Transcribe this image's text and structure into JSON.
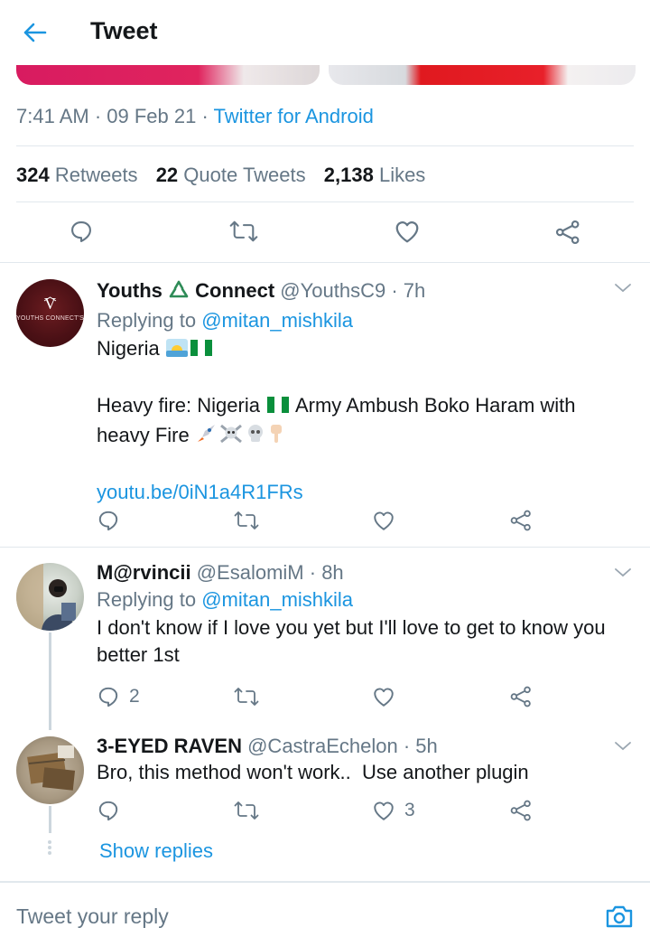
{
  "header": {
    "title": "Tweet"
  },
  "tweet": {
    "time": "7:41 AM",
    "date": "09 Feb 21",
    "source": "Twitter for Android",
    "retweets_count": "324",
    "retweets_label": "Retweets",
    "quotes_count": "22",
    "quotes_label": "Quote Tweets",
    "likes_count": "2,138",
    "likes_label": "Likes"
  },
  "replies": [
    {
      "name_a": "Youths",
      "name_emoji": "♻️",
      "name_b": "Connect",
      "handle": "@YouthsC9",
      "time": "7h",
      "replying_label": "Replying to",
      "replying_to": "@mitan_mishkila",
      "line1": "Nigeria",
      "line2a": "Heavy fire: Nigeria",
      "line2b": "Army Ambush Boko Haram with",
      "line3": "heavy Fire",
      "link": "youtu.be/0iN1a4R1FRs",
      "avatar_text": "YOUTHS CONNECT'S",
      "reply_count": "",
      "like_count": ""
    },
    {
      "name": "M@rvincii",
      "handle": "@EsalomiM",
      "time": "8h",
      "replying_label": "Replying to",
      "replying_to": "@mitan_mishkila",
      "line1": "I don't know if I love you yet but I'll love to get to know you",
      "line2": "better 1st",
      "reply_count": "2",
      "like_count": ""
    },
    {
      "name": "3-EYED RAVEN",
      "handle": "@CastraEchelon",
      "time": "5h",
      "line1": "Bro, this method won't work..  Use another plugin",
      "reply_count": "",
      "like_count": "3"
    }
  ],
  "show_replies": "Show replies",
  "reply_box": {
    "placeholder": "Tweet your reply"
  },
  "colors": {
    "accent": "#1b95e0",
    "muted": "#657786",
    "text": "#14171a",
    "divider": "#e1e8ed"
  },
  "icons": [
    "back-arrow-icon",
    "reply-icon",
    "retweet-icon",
    "like-icon",
    "share-icon",
    "chevron-down-icon",
    "camera-icon"
  ]
}
